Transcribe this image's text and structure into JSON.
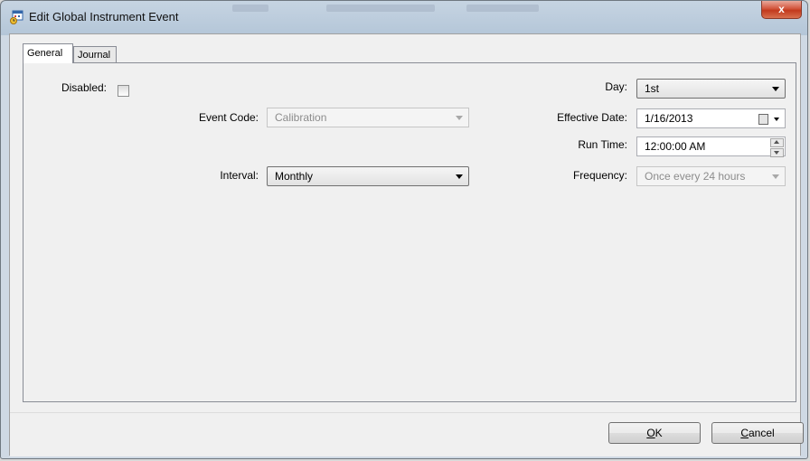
{
  "window": {
    "title": "Edit Global Instrument Event",
    "close_symbol": "x"
  },
  "tabs": [
    {
      "label": "General",
      "active": true
    },
    {
      "label": "Journal",
      "active": false
    }
  ],
  "form": {
    "disabled": {
      "label": "Disabled:",
      "checked": false
    },
    "event_code": {
      "label": "Event Code:",
      "value": "Calibration",
      "enabled": false
    },
    "interval": {
      "label": "Interval:",
      "value": "Monthly"
    },
    "day": {
      "label": "Day:",
      "value": "1st"
    },
    "effective_date": {
      "label": "Effective Date:",
      "value": "1/16/2013"
    },
    "run_time": {
      "label": "Run Time:",
      "value": "12:00:00 AM"
    },
    "frequency": {
      "label": "Frequency:",
      "value": "Once every 24 hours",
      "enabled": false
    }
  },
  "buttons": {
    "ok": {
      "mnemonic": "O",
      "rest": "K"
    },
    "cancel": {
      "mnemonic": "C",
      "rest": "ancel"
    }
  },
  "icons": {
    "title": "event-calendar-icon",
    "dropdown": "chevron-down-icon",
    "calendar": "calendar-icon",
    "spinner": "spinner-icon"
  }
}
